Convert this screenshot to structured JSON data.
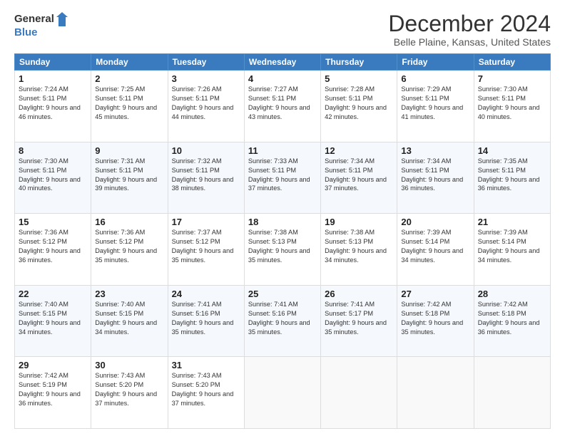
{
  "header": {
    "logo_general": "General",
    "logo_blue": "Blue",
    "month_title": "December 2024",
    "location": "Belle Plaine, Kansas, United States"
  },
  "weekdays": [
    "Sunday",
    "Monday",
    "Tuesday",
    "Wednesday",
    "Thursday",
    "Friday",
    "Saturday"
  ],
  "weeks": [
    [
      {
        "day": 1,
        "sunrise": "Sunrise: 7:24 AM",
        "sunset": "Sunset: 5:11 PM",
        "daylight": "Daylight: 9 hours and 46 minutes."
      },
      {
        "day": 2,
        "sunrise": "Sunrise: 7:25 AM",
        "sunset": "Sunset: 5:11 PM",
        "daylight": "Daylight: 9 hours and 45 minutes."
      },
      {
        "day": 3,
        "sunrise": "Sunrise: 7:26 AM",
        "sunset": "Sunset: 5:11 PM",
        "daylight": "Daylight: 9 hours and 44 minutes."
      },
      {
        "day": 4,
        "sunrise": "Sunrise: 7:27 AM",
        "sunset": "Sunset: 5:11 PM",
        "daylight": "Daylight: 9 hours and 43 minutes."
      },
      {
        "day": 5,
        "sunrise": "Sunrise: 7:28 AM",
        "sunset": "Sunset: 5:11 PM",
        "daylight": "Daylight: 9 hours and 42 minutes."
      },
      {
        "day": 6,
        "sunrise": "Sunrise: 7:29 AM",
        "sunset": "Sunset: 5:11 PM",
        "daylight": "Daylight: 9 hours and 41 minutes."
      },
      {
        "day": 7,
        "sunrise": "Sunrise: 7:30 AM",
        "sunset": "Sunset: 5:11 PM",
        "daylight": "Daylight: 9 hours and 40 minutes."
      }
    ],
    [
      {
        "day": 8,
        "sunrise": "Sunrise: 7:30 AM",
        "sunset": "Sunset: 5:11 PM",
        "daylight": "Daylight: 9 hours and 40 minutes."
      },
      {
        "day": 9,
        "sunrise": "Sunrise: 7:31 AM",
        "sunset": "Sunset: 5:11 PM",
        "daylight": "Daylight: 9 hours and 39 minutes."
      },
      {
        "day": 10,
        "sunrise": "Sunrise: 7:32 AM",
        "sunset": "Sunset: 5:11 PM",
        "daylight": "Daylight: 9 hours and 38 minutes."
      },
      {
        "day": 11,
        "sunrise": "Sunrise: 7:33 AM",
        "sunset": "Sunset: 5:11 PM",
        "daylight": "Daylight: 9 hours and 37 minutes."
      },
      {
        "day": 12,
        "sunrise": "Sunrise: 7:34 AM",
        "sunset": "Sunset: 5:11 PM",
        "daylight": "Daylight: 9 hours and 37 minutes."
      },
      {
        "day": 13,
        "sunrise": "Sunrise: 7:34 AM",
        "sunset": "Sunset: 5:11 PM",
        "daylight": "Daylight: 9 hours and 36 minutes."
      },
      {
        "day": 14,
        "sunrise": "Sunrise: 7:35 AM",
        "sunset": "Sunset: 5:11 PM",
        "daylight": "Daylight: 9 hours and 36 minutes."
      }
    ],
    [
      {
        "day": 15,
        "sunrise": "Sunrise: 7:36 AM",
        "sunset": "Sunset: 5:12 PM",
        "daylight": "Daylight: 9 hours and 36 minutes."
      },
      {
        "day": 16,
        "sunrise": "Sunrise: 7:36 AM",
        "sunset": "Sunset: 5:12 PM",
        "daylight": "Daylight: 9 hours and 35 minutes."
      },
      {
        "day": 17,
        "sunrise": "Sunrise: 7:37 AM",
        "sunset": "Sunset: 5:12 PM",
        "daylight": "Daylight: 9 hours and 35 minutes."
      },
      {
        "day": 18,
        "sunrise": "Sunrise: 7:38 AM",
        "sunset": "Sunset: 5:13 PM",
        "daylight": "Daylight: 9 hours and 35 minutes."
      },
      {
        "day": 19,
        "sunrise": "Sunrise: 7:38 AM",
        "sunset": "Sunset: 5:13 PM",
        "daylight": "Daylight: 9 hours and 34 minutes."
      },
      {
        "day": 20,
        "sunrise": "Sunrise: 7:39 AM",
        "sunset": "Sunset: 5:14 PM",
        "daylight": "Daylight: 9 hours and 34 minutes."
      },
      {
        "day": 21,
        "sunrise": "Sunrise: 7:39 AM",
        "sunset": "Sunset: 5:14 PM",
        "daylight": "Daylight: 9 hours and 34 minutes."
      }
    ],
    [
      {
        "day": 22,
        "sunrise": "Sunrise: 7:40 AM",
        "sunset": "Sunset: 5:15 PM",
        "daylight": "Daylight: 9 hours and 34 minutes."
      },
      {
        "day": 23,
        "sunrise": "Sunrise: 7:40 AM",
        "sunset": "Sunset: 5:15 PM",
        "daylight": "Daylight: 9 hours and 34 minutes."
      },
      {
        "day": 24,
        "sunrise": "Sunrise: 7:41 AM",
        "sunset": "Sunset: 5:16 PM",
        "daylight": "Daylight: 9 hours and 35 minutes."
      },
      {
        "day": 25,
        "sunrise": "Sunrise: 7:41 AM",
        "sunset": "Sunset: 5:16 PM",
        "daylight": "Daylight: 9 hours and 35 minutes."
      },
      {
        "day": 26,
        "sunrise": "Sunrise: 7:41 AM",
        "sunset": "Sunset: 5:17 PM",
        "daylight": "Daylight: 9 hours and 35 minutes."
      },
      {
        "day": 27,
        "sunrise": "Sunrise: 7:42 AM",
        "sunset": "Sunset: 5:18 PM",
        "daylight": "Daylight: 9 hours and 35 minutes."
      },
      {
        "day": 28,
        "sunrise": "Sunrise: 7:42 AM",
        "sunset": "Sunset: 5:18 PM",
        "daylight": "Daylight: 9 hours and 36 minutes."
      }
    ],
    [
      {
        "day": 29,
        "sunrise": "Sunrise: 7:42 AM",
        "sunset": "Sunset: 5:19 PM",
        "daylight": "Daylight: 9 hours and 36 minutes."
      },
      {
        "day": 30,
        "sunrise": "Sunrise: 7:43 AM",
        "sunset": "Sunset: 5:20 PM",
        "daylight": "Daylight: 9 hours and 37 minutes."
      },
      {
        "day": 31,
        "sunrise": "Sunrise: 7:43 AM",
        "sunset": "Sunset: 5:20 PM",
        "daylight": "Daylight: 9 hours and 37 minutes."
      },
      null,
      null,
      null,
      null
    ]
  ]
}
